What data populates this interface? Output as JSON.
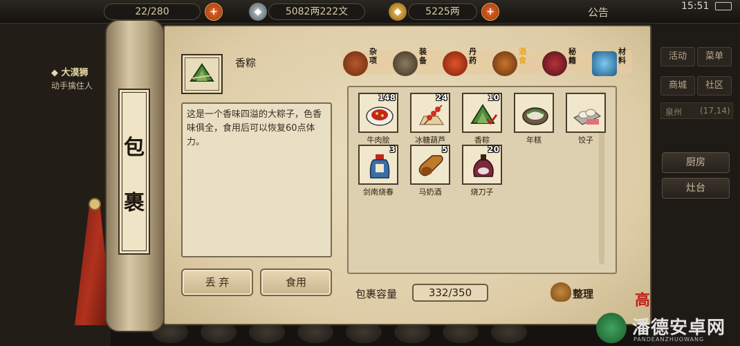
{
  "hud": {
    "stamina": "22/280",
    "copper": "5082两222文",
    "gold": "5225两",
    "notice": "公告",
    "clock": "15:51"
  },
  "quest": {
    "title": "◆ 大漠狮",
    "desc": "动手擒住人"
  },
  "side_menu": {
    "activity": "活动",
    "menu": "菜单",
    "shop": "商城",
    "community": "社区",
    "location": "泉州",
    "coords": "(17,14)",
    "kitchen": "厨房",
    "stove": "灶台"
  },
  "scroll_label": {
    "char1": "包",
    "char2": "裹"
  },
  "selected": {
    "name": "香粽",
    "description": "这是一个香味四溢的大粽子，色香味俱全，食用后可以恢复60点体力。",
    "icon": "zongzi-icon"
  },
  "actions": {
    "discard": "丢 弃",
    "eat": "食用"
  },
  "tabs": [
    {
      "label": "杂项",
      "icon": "jar-icon",
      "active": false
    },
    {
      "label": "装备",
      "icon": "weapon-icon",
      "active": false
    },
    {
      "label": "丹药",
      "icon": "pill-icon",
      "active": false
    },
    {
      "label": "酒食",
      "icon": "food-icon",
      "active": true
    },
    {
      "label": "秘籍",
      "icon": "book-icon",
      "active": false
    },
    {
      "label": "材料",
      "icon": "crystal-icon",
      "active": false
    }
  ],
  "items": [
    {
      "name": "牛肉脍",
      "count": "148",
      "icon": "beef-dish-icon"
    },
    {
      "name": "冰糖葫芦",
      "count": "24",
      "icon": "tanghulu-icon"
    },
    {
      "name": "香粽",
      "count": "10",
      "icon": "zongzi-icon"
    },
    {
      "name": "年糕",
      "count": "",
      "icon": "niangao-icon"
    },
    {
      "name": "饺子",
      "count": "",
      "icon": "dumpling-icon"
    },
    {
      "name": "剑南烧春",
      "count": "3",
      "icon": "wine-bottle-icon"
    },
    {
      "name": "马奶酒",
      "count": "5",
      "icon": "wine-gourd-icon"
    },
    {
      "name": "烧刀子",
      "count": "20",
      "icon": "wine-jug-icon"
    }
  ],
  "capacity": {
    "label": "包裹容量",
    "value": "332/350"
  },
  "sort_label": "整理",
  "colors": {
    "paper": "#ddcca6",
    "accent": "#e6a81f",
    "ribbon": "#b1321e"
  },
  "watermark": {
    "text": "潘德安卓网",
    "sub": "PANDEANZHUOWANG"
  }
}
